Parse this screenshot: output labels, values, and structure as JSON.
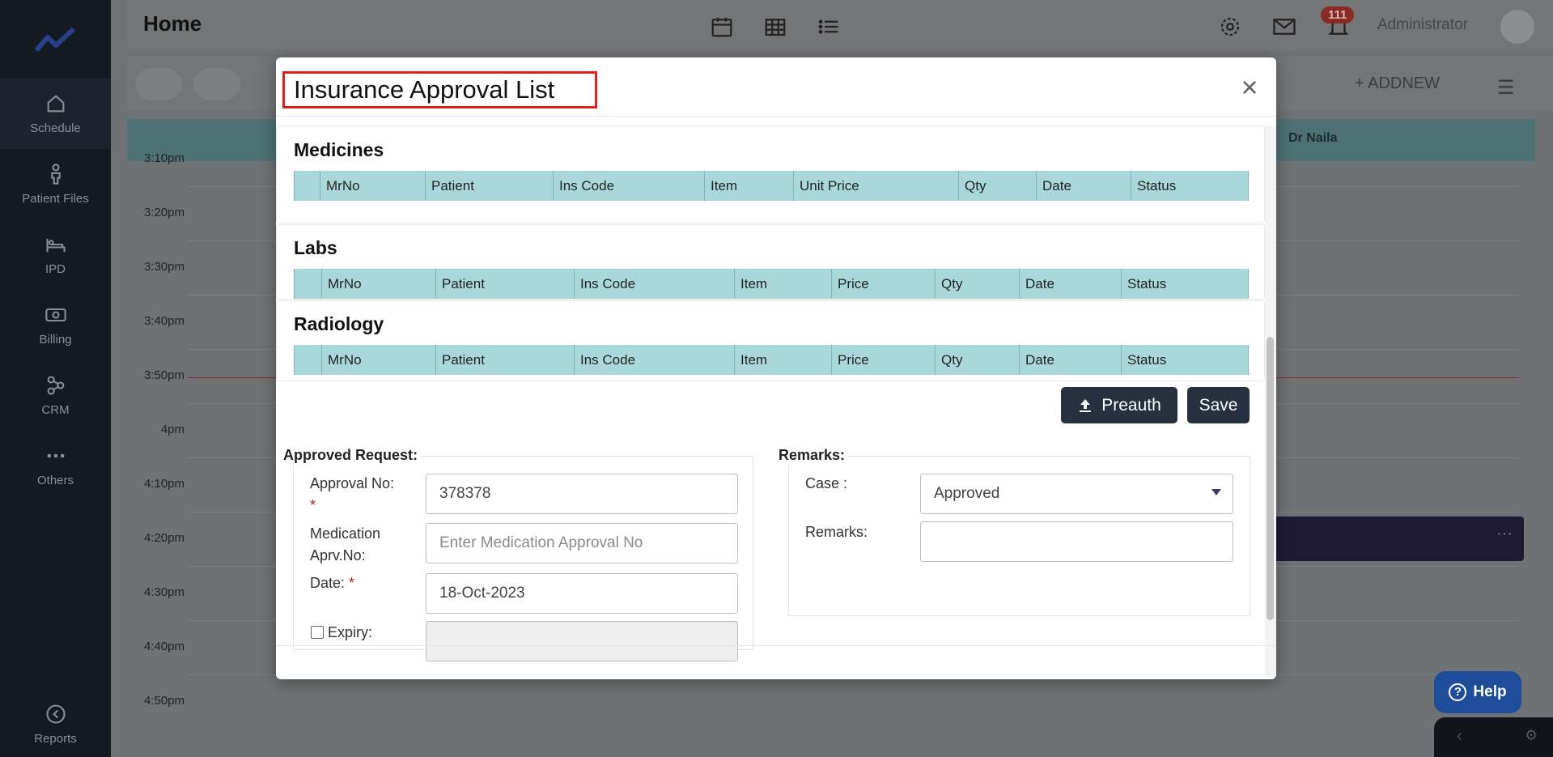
{
  "sidebar": {
    "items": [
      {
        "label": "Schedule",
        "icon": "home-icon"
      },
      {
        "label": "Patient Files",
        "icon": "person-icon"
      },
      {
        "label": "IPD",
        "icon": "bed-icon"
      },
      {
        "label": "Billing",
        "icon": "cash-icon"
      },
      {
        "label": "CRM",
        "icon": "network-icon"
      },
      {
        "label": "Others",
        "icon": "dots-icon"
      }
    ],
    "reports_label": "Reports"
  },
  "topbar": {
    "title": "Home",
    "notification_count": "111",
    "user_name": "Administrator"
  },
  "toolbar": {
    "add_new_label": "ADDNEW"
  },
  "calendar": {
    "doctor": "Dr Naila",
    "times": [
      "3:10pm",
      "3:20pm",
      "3:30pm",
      "3:40pm",
      "3:50pm",
      "4pm",
      "4:10pm",
      "4:20pm",
      "4:30pm",
      "4:40pm",
      "4:50pm"
    ]
  },
  "help_label": "Help",
  "modal": {
    "title": "Insurance Approval List",
    "medicines": {
      "title": "Medicines",
      "columns": [
        "",
        "MrNo",
        "Patient",
        "Ins Code",
        "Item",
        "Unit Price",
        "Qty",
        "Date",
        "Status"
      ]
    },
    "labs": {
      "title": "Labs",
      "columns": [
        "",
        "MrNo",
        "Patient",
        "Ins Code",
        "Item",
        "Price",
        "Qty",
        "Date",
        "Status"
      ]
    },
    "radiology": {
      "title": "Radiology",
      "columns": [
        "",
        "MrNo",
        "Patient",
        "Ins Code",
        "Item",
        "Price",
        "Qty",
        "Date",
        "Status"
      ]
    },
    "preauth_label": "Preauth",
    "save_label": "Save",
    "approved_request": {
      "legend": "Approved Request:",
      "approval_no_label": "Approval No:",
      "approval_no_value": "378378",
      "medication_label_1": "Medication",
      "medication_label_2": "Aprv.No:",
      "medication_placeholder": "Enter Medication Approval No",
      "date_label": "Date:",
      "date_value": "18-Oct-2023",
      "expiry_label": "Expiry:",
      "required_mark": "*"
    },
    "remarks": {
      "legend": "Remarks:",
      "case_label": "Case :",
      "case_value": "Approved",
      "remarks_label": "Remarks:",
      "remarks_value": ""
    }
  }
}
